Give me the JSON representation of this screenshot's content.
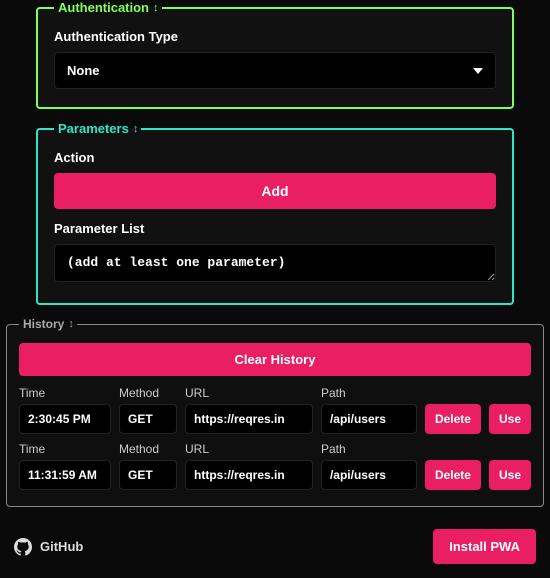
{
  "auth": {
    "legend": "Authentication",
    "type_label": "Authentication Type",
    "selected": "None"
  },
  "params": {
    "legend": "Parameters",
    "action_label": "Action",
    "add_label": "Add",
    "list_label": "Parameter List",
    "list_value": "(add at least one parameter)"
  },
  "history": {
    "legend": "History",
    "clear_label": "Clear History",
    "headers": {
      "time": "Time",
      "method": "Method",
      "url": "URL",
      "path": "Path"
    },
    "rows": [
      {
        "time": "2:30:45 PM",
        "method": "GET",
        "url": "https://reqres.in",
        "path": "/api/users"
      },
      {
        "time": "11:31:59 AM",
        "method": "GET",
        "url": "https://reqres.in",
        "path": "/api/users"
      }
    ],
    "delete_label": "Delete",
    "use_label": "Use"
  },
  "footer": {
    "github_label": "GitHub",
    "install_label": "Install PWA"
  },
  "colors": {
    "accent_green": "#7fff5a",
    "accent_teal": "#2ee6c4",
    "accent_pink": "#e91e63"
  }
}
